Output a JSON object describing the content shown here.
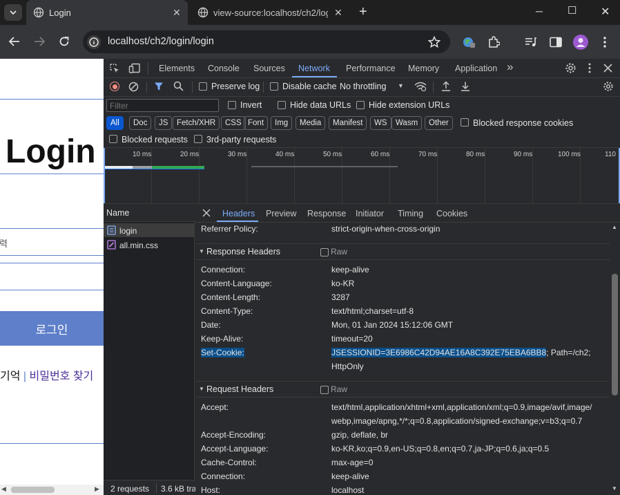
{
  "tabs": [
    {
      "title": "Login",
      "close": "✕"
    },
    {
      "title": "view-source:localhost/ch2/logi",
      "close": "✕"
    }
  ],
  "new_tab": "+",
  "address": "localhost/ch2/login/login",
  "window": {
    "min": "─",
    "max": "☐",
    "close": "✕"
  },
  "page": {
    "heading": "Login",
    "input1_hint": "력",
    "button": "로그인",
    "link_a": "기억",
    "sep": "|",
    "link_b": "비밀번호 찾기"
  },
  "devtools": {
    "panels": [
      "Elements",
      "Console",
      "Sources",
      "Network",
      "Performance",
      "Memory",
      "Application"
    ],
    "more": "»",
    "toolbar": {
      "preserve_log": "Preserve log",
      "disable_cache": "Disable cache",
      "throttling": "No throttling"
    },
    "filter": {
      "placeholder": "Filter",
      "invert": "Invert",
      "hide_data": "Hide data URLs",
      "hide_ext": "Hide extension URLs"
    },
    "types": [
      "All",
      "Doc",
      "JS",
      "Fetch/XHR",
      "CSS",
      "Font",
      "Img",
      "Media",
      "Manifest",
      "WS",
      "Wasm",
      "Other"
    ],
    "blocked_cookies": "Blocked response cookies",
    "blocked_requests": "Blocked requests",
    "third_party": "3rd-party requests",
    "ticks": [
      "10 ms",
      "20 ms",
      "30 ms",
      "40 ms",
      "50 ms",
      "60 ms",
      "70 ms",
      "80 ms",
      "90 ms",
      "100 ms",
      "110"
    ],
    "name_col": "Name",
    "files": [
      "login",
      "all.min.css"
    ],
    "status": "2 requests",
    "transferred": "3.6 kB tra",
    "detail_tabs": [
      "Headers",
      "Preview",
      "Response",
      "Initiator",
      "Timing",
      "Cookies"
    ],
    "referrer": {
      "name": "Referrer Policy:",
      "value": "strict-origin-when-cross-origin"
    },
    "resp_title": "Response Headers",
    "raw": "Raw",
    "response_headers": [
      {
        "name": "Connection:",
        "value": "keep-alive"
      },
      {
        "name": "Content-Language:",
        "value": "ko-KR"
      },
      {
        "name": "Content-Length:",
        "value": "3287"
      },
      {
        "name": "Content-Type:",
        "value": "text/html;charset=utf-8"
      },
      {
        "name": "Date:",
        "value": "Mon, 01 Jan 2024 15:12:06 GMT"
      },
      {
        "name": "Keep-Alive:",
        "value": "timeout=20"
      }
    ],
    "set_cookie": {
      "name": "Set-Cookie:",
      "value": "JSESSIONID=3E6986C42D94AE16A8C392E75EBA6BB8",
      "rest": "; Path=/ch2;",
      "line2": "HttpOnly"
    },
    "req_title": "Request Headers",
    "accept": {
      "name": "Accept:",
      "line1": "text/html,application/xhtml+xml,application/xml;q=0.9,image/avif,image/",
      "line2": "webp,image/apng,*/*;q=0.8,application/signed-exchange;v=b3;q=0.7"
    },
    "request_headers": [
      {
        "name": "Accept-Encoding:",
        "value": "gzip, deflate, br"
      },
      {
        "name": "Accept-Language:",
        "value": "ko-KR,ko;q=0.9,en-US;q=0.8,en;q=0.7,ja-JP;q=0.6,ja;q=0.5"
      },
      {
        "name": "Cache-Control:",
        "value": "max-age=0"
      },
      {
        "name": "Connection:",
        "value": "keep-alive"
      },
      {
        "name": "Host:",
        "value": "localhost"
      }
    ]
  },
  "colors": {
    "accent": "#7cacf8",
    "selection": "#0b4f8a",
    "page_button": "#5e7fc9",
    "link": "#4b2f9a"
  }
}
